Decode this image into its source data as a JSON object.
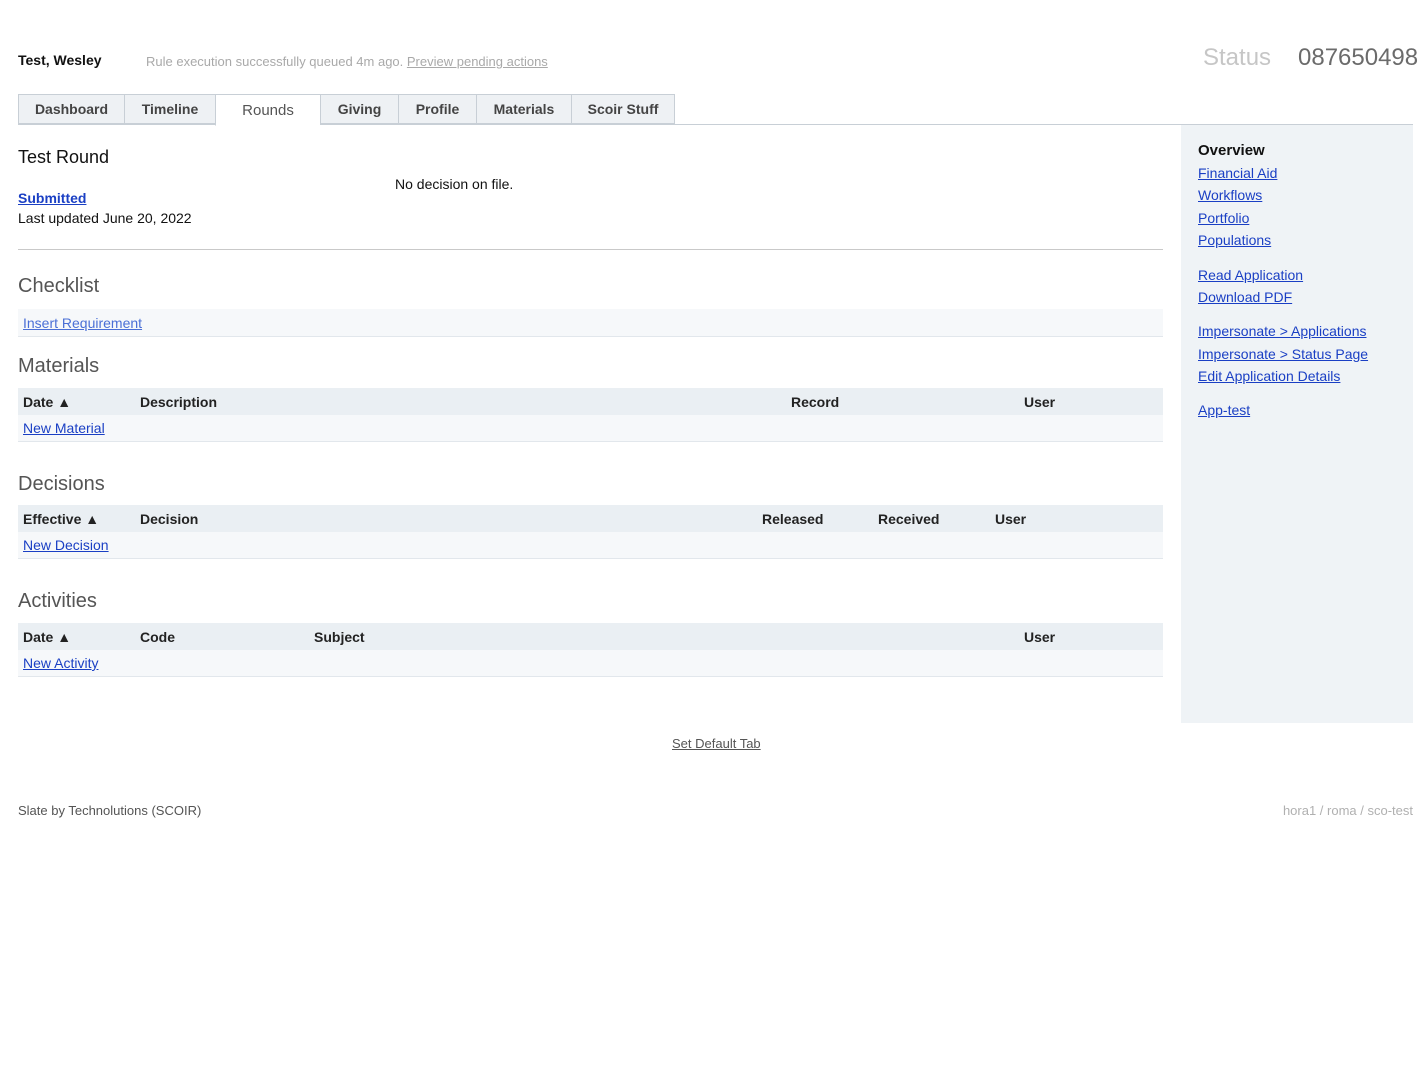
{
  "header": {
    "person_name": "Test, Wesley",
    "message": "Rule execution successfully queued 4m ago.",
    "message_link": "Preview pending actions",
    "status_label": "Status",
    "record_id": "087650498"
  },
  "tabs": [
    {
      "label": "Dashboard"
    },
    {
      "label": "Timeline"
    },
    {
      "label": "Rounds",
      "active": true
    },
    {
      "label": "Giving"
    },
    {
      "label": "Profile"
    },
    {
      "label": "Materials"
    },
    {
      "label": "Scoir Stuff"
    }
  ],
  "round": {
    "title": "Test Round",
    "status_link": "Submitted",
    "last_updated": "Last updated June 20, 2022",
    "decision_text": "No decision on file."
  },
  "checklist": {
    "title": "Checklist",
    "insert_link": "Insert Requirement"
  },
  "materials": {
    "title": "Materials",
    "columns": [
      "Date ▲",
      "Description",
      "Record",
      "User"
    ],
    "new_link": "New Material"
  },
  "decisions": {
    "title": "Decisions",
    "columns": [
      "Effective ▲",
      "Decision",
      "Released",
      "Received",
      "User"
    ],
    "new_link": "New Decision"
  },
  "activities": {
    "title": "Activities",
    "columns": [
      "Date ▲",
      "Code",
      "Subject",
      "User"
    ],
    "new_link": "New Activity"
  },
  "sidebar": {
    "heading": "Overview",
    "links": [
      "Financial Aid",
      "Workflows",
      "Portfolio",
      "Populations",
      "Read Application",
      "Download PDF",
      "Impersonate > Applications",
      "Impersonate > Status Page",
      "Edit Application Details",
      "App-test"
    ]
  },
  "footer": {
    "set_default": "Set Default Tab",
    "left": "Slate by Technolutions (SCOIR)",
    "right": "hora1 / roma / sco-test"
  },
  "colors": {
    "link": "#1a3fc4",
    "table_header_bg": "#eaeff3",
    "sidebar_bg": "#eff3f6"
  }
}
